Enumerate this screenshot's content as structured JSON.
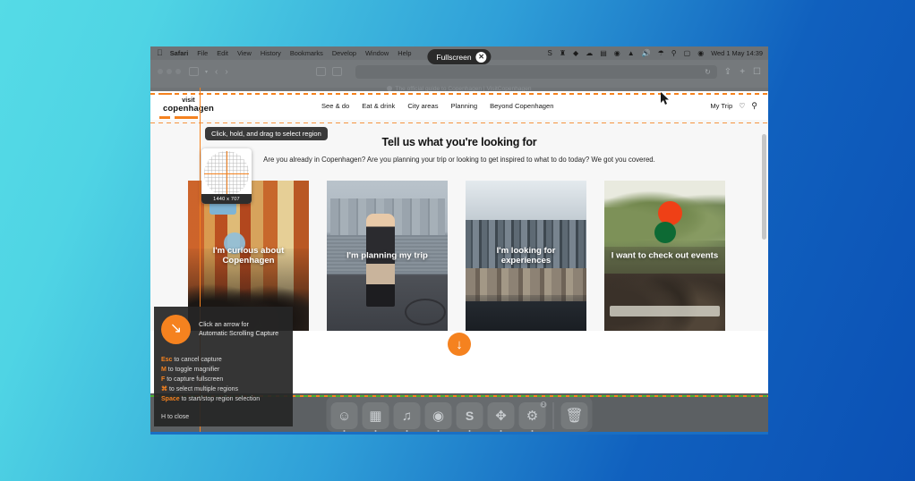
{
  "desktop": {
    "background_from": "#55dbe6",
    "background_to": "#0b50b4"
  },
  "menubar": {
    "apple_icon": "apple-icon",
    "items": [
      "Safari",
      "File",
      "Edit",
      "View",
      "History",
      "Bookmarks",
      "Develop",
      "Window",
      "Help"
    ],
    "status_icons": [
      "skype-icon",
      "mailbird-icon",
      "dropbox-icon",
      "cloud-icon",
      "airplay-icon",
      "timemachine-icon",
      "adobe-icon",
      "volume-icon",
      "wifi-icon",
      "spotlight-icon",
      "user-icon",
      "controlcenter-icon"
    ],
    "clock": "Wed 1 May  14:39"
  },
  "browser": {
    "traffic_lights": [
      "close",
      "minimize",
      "zoom"
    ],
    "sidebar_icon": "sidebar-icon",
    "back_label": "‹",
    "forward_label": "›",
    "tabs_icon": "tabs-overview-icon",
    "url_value": "",
    "reload_icon": "reload-icon",
    "share_icon": "share-icon",
    "newtab_icon": "new-tab-icon",
    "tabgroup_icon": "tab-group-icon",
    "favorites_title": "The official guide to Copenhagen | VisitCopenhagen",
    "fullscreen_pill": {
      "label": "Fullscreen",
      "close_label": "✕"
    }
  },
  "site": {
    "logo_line1": "visit",
    "logo_line2": "copenhagen",
    "nav": [
      "See & do",
      "Eat & drink",
      "City areas",
      "Planning",
      "Beyond Copenhagen"
    ],
    "my_trip_label": "My Trip",
    "heart_icon": "heart-icon",
    "search_icon": "search-icon",
    "hero_title": "Tell us what you're looking for",
    "hero_paragraph": "Are you already in Copenhagen? Are you planning your trip or looking to get inspired to what to do today? We got you covered.",
    "cards": [
      {
        "title": "I'm curious about Copenhagen"
      },
      {
        "title": "I'm planning my trip"
      },
      {
        "title": "I'm looking for experiences"
      },
      {
        "title": "I want to check out events"
      }
    ],
    "scroll_down_label": "↓"
  },
  "snagit": {
    "tooltip": "Click, hold, and drag to select region",
    "magnifier_dimensions": "1440 x 707",
    "arrow_hint_line1": "Click an arrow for",
    "arrow_hint_line2": "Automatic Scrolling Capture",
    "arrow_glyph": "↘",
    "shortcuts": [
      {
        "key": "Esc",
        "action": "to cancel capture"
      },
      {
        "key": "M",
        "action": "to toggle magnifier"
      },
      {
        "key": "F",
        "action": "to capture fullscreen"
      },
      {
        "key": "⌘",
        "action": "to select multiple regions"
      },
      {
        "key": "Space",
        "action": "to start/stop region selection"
      }
    ],
    "close_hint": "H to close",
    "accent_color": "#f5821f"
  },
  "dock": {
    "apps": [
      {
        "name": "finder-icon",
        "glyph": "◑"
      },
      {
        "name": "launchpad-icon",
        "glyph": "∷"
      },
      {
        "name": "music-icon",
        "glyph": "♫"
      },
      {
        "name": "chrome-icon",
        "glyph": "◉"
      },
      {
        "name": "snagit-icon",
        "glyph": "S"
      },
      {
        "name": "safari-icon",
        "glyph": "✆"
      },
      {
        "name": "settings-icon",
        "glyph": "❁"
      }
    ],
    "trash": {
      "name": "trash-icon",
      "glyph": "□"
    },
    "badge": "3"
  }
}
